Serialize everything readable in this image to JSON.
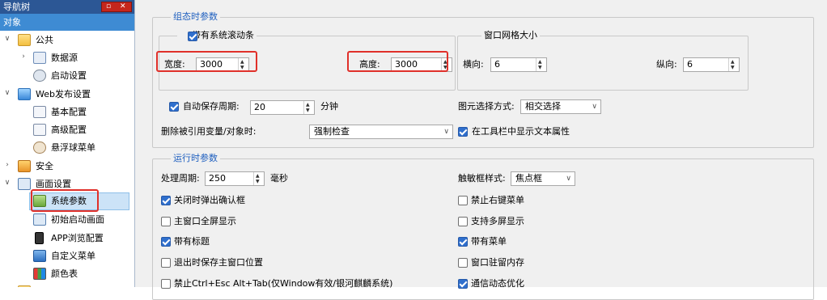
{
  "nav": {
    "title": "导航树",
    "window_buttons": [
      "▫",
      "✕"
    ],
    "subtitle": "对象",
    "items": [
      {
        "label": "公共",
        "level": 0,
        "expanded": true,
        "icon": "folder-icon"
      },
      {
        "label": "数据源",
        "level": 1,
        "expanded": false,
        "icon": "database-icon"
      },
      {
        "label": "启动设置",
        "level": 1,
        "icon": "gear-icon"
      },
      {
        "label": "Web发布设置",
        "level": 0,
        "expanded": true,
        "icon": "web-icon"
      },
      {
        "label": "基本配置",
        "level": 1,
        "icon": "document-icon"
      },
      {
        "label": "高级配置",
        "level": 1,
        "icon": "document-icon"
      },
      {
        "label": "悬浮球菜单",
        "level": 1,
        "icon": "user-icon"
      },
      {
        "label": "安全",
        "level": 0,
        "expanded": false,
        "icon": "shield-icon"
      },
      {
        "label": "画面设置",
        "level": 0,
        "expanded": true,
        "icon": "screen-settings-icon"
      },
      {
        "label": "系统参数",
        "level": 1,
        "icon": "system-params-icon",
        "selected": true
      },
      {
        "label": "初始启动画面",
        "level": 1,
        "icon": "startup-screen-icon"
      },
      {
        "label": "APP浏览配置",
        "level": 1,
        "icon": "phone-icon"
      },
      {
        "label": "自定义菜单",
        "level": 1,
        "icon": "menu-icon"
      },
      {
        "label": "颜色表",
        "level": 1,
        "icon": "color-table-icon"
      }
    ]
  },
  "config": {
    "title": "组态时参数",
    "scrollbar": {
      "label": "带有系统滚动条",
      "checked": true,
      "width_label": "宽度:",
      "width_value": "3000",
      "height_label": "高度:",
      "height_value": "3000"
    },
    "grid": {
      "title": "窗口网格大小",
      "h_label": "横向:",
      "h_value": "6",
      "v_label": "纵向:",
      "v_value": "6"
    },
    "autosave": {
      "label": "自动保存周期:",
      "checked": true,
      "value": "20",
      "unit": "分钟"
    },
    "select_mode": {
      "label": "图元选择方式:",
      "value": "相交选择"
    },
    "delete_ref": {
      "label": "删除被引用变量/对象时:",
      "value": "强制检查"
    },
    "show_text_attr": {
      "label": "在工具栏中显示文本属性",
      "checked": true
    }
  },
  "runtime": {
    "title": "运行时参数",
    "period": {
      "label": "处理周期:",
      "value": "250",
      "unit": "毫秒"
    },
    "touch_style": {
      "label": "触敏框样式:",
      "value": "焦点框"
    },
    "left_options": [
      {
        "label": "关闭时弹出确认框",
        "checked": true
      },
      {
        "label": "主窗口全屏显示",
        "checked": false
      },
      {
        "label": "带有标题",
        "checked": true
      },
      {
        "label": "退出时保存主窗口位置",
        "checked": false
      },
      {
        "label": "禁止Ctrl+Esc Alt+Tab(仅Window有效/银河麒麟系统)",
        "checked": false
      }
    ],
    "right_options": [
      {
        "label": "禁止右键菜单",
        "checked": false
      },
      {
        "label": "支持多屏显示",
        "checked": false
      },
      {
        "label": "带有菜单",
        "checked": true
      },
      {
        "label": "窗口驻留内存",
        "checked": false
      },
      {
        "label": "通信动态优化",
        "checked": true
      }
    ]
  },
  "colors": {
    "accent": "#2f6fcd",
    "highlight_box": "#e0302a",
    "title_bar": "#2c5795",
    "group_title": "#1e5fbf"
  }
}
